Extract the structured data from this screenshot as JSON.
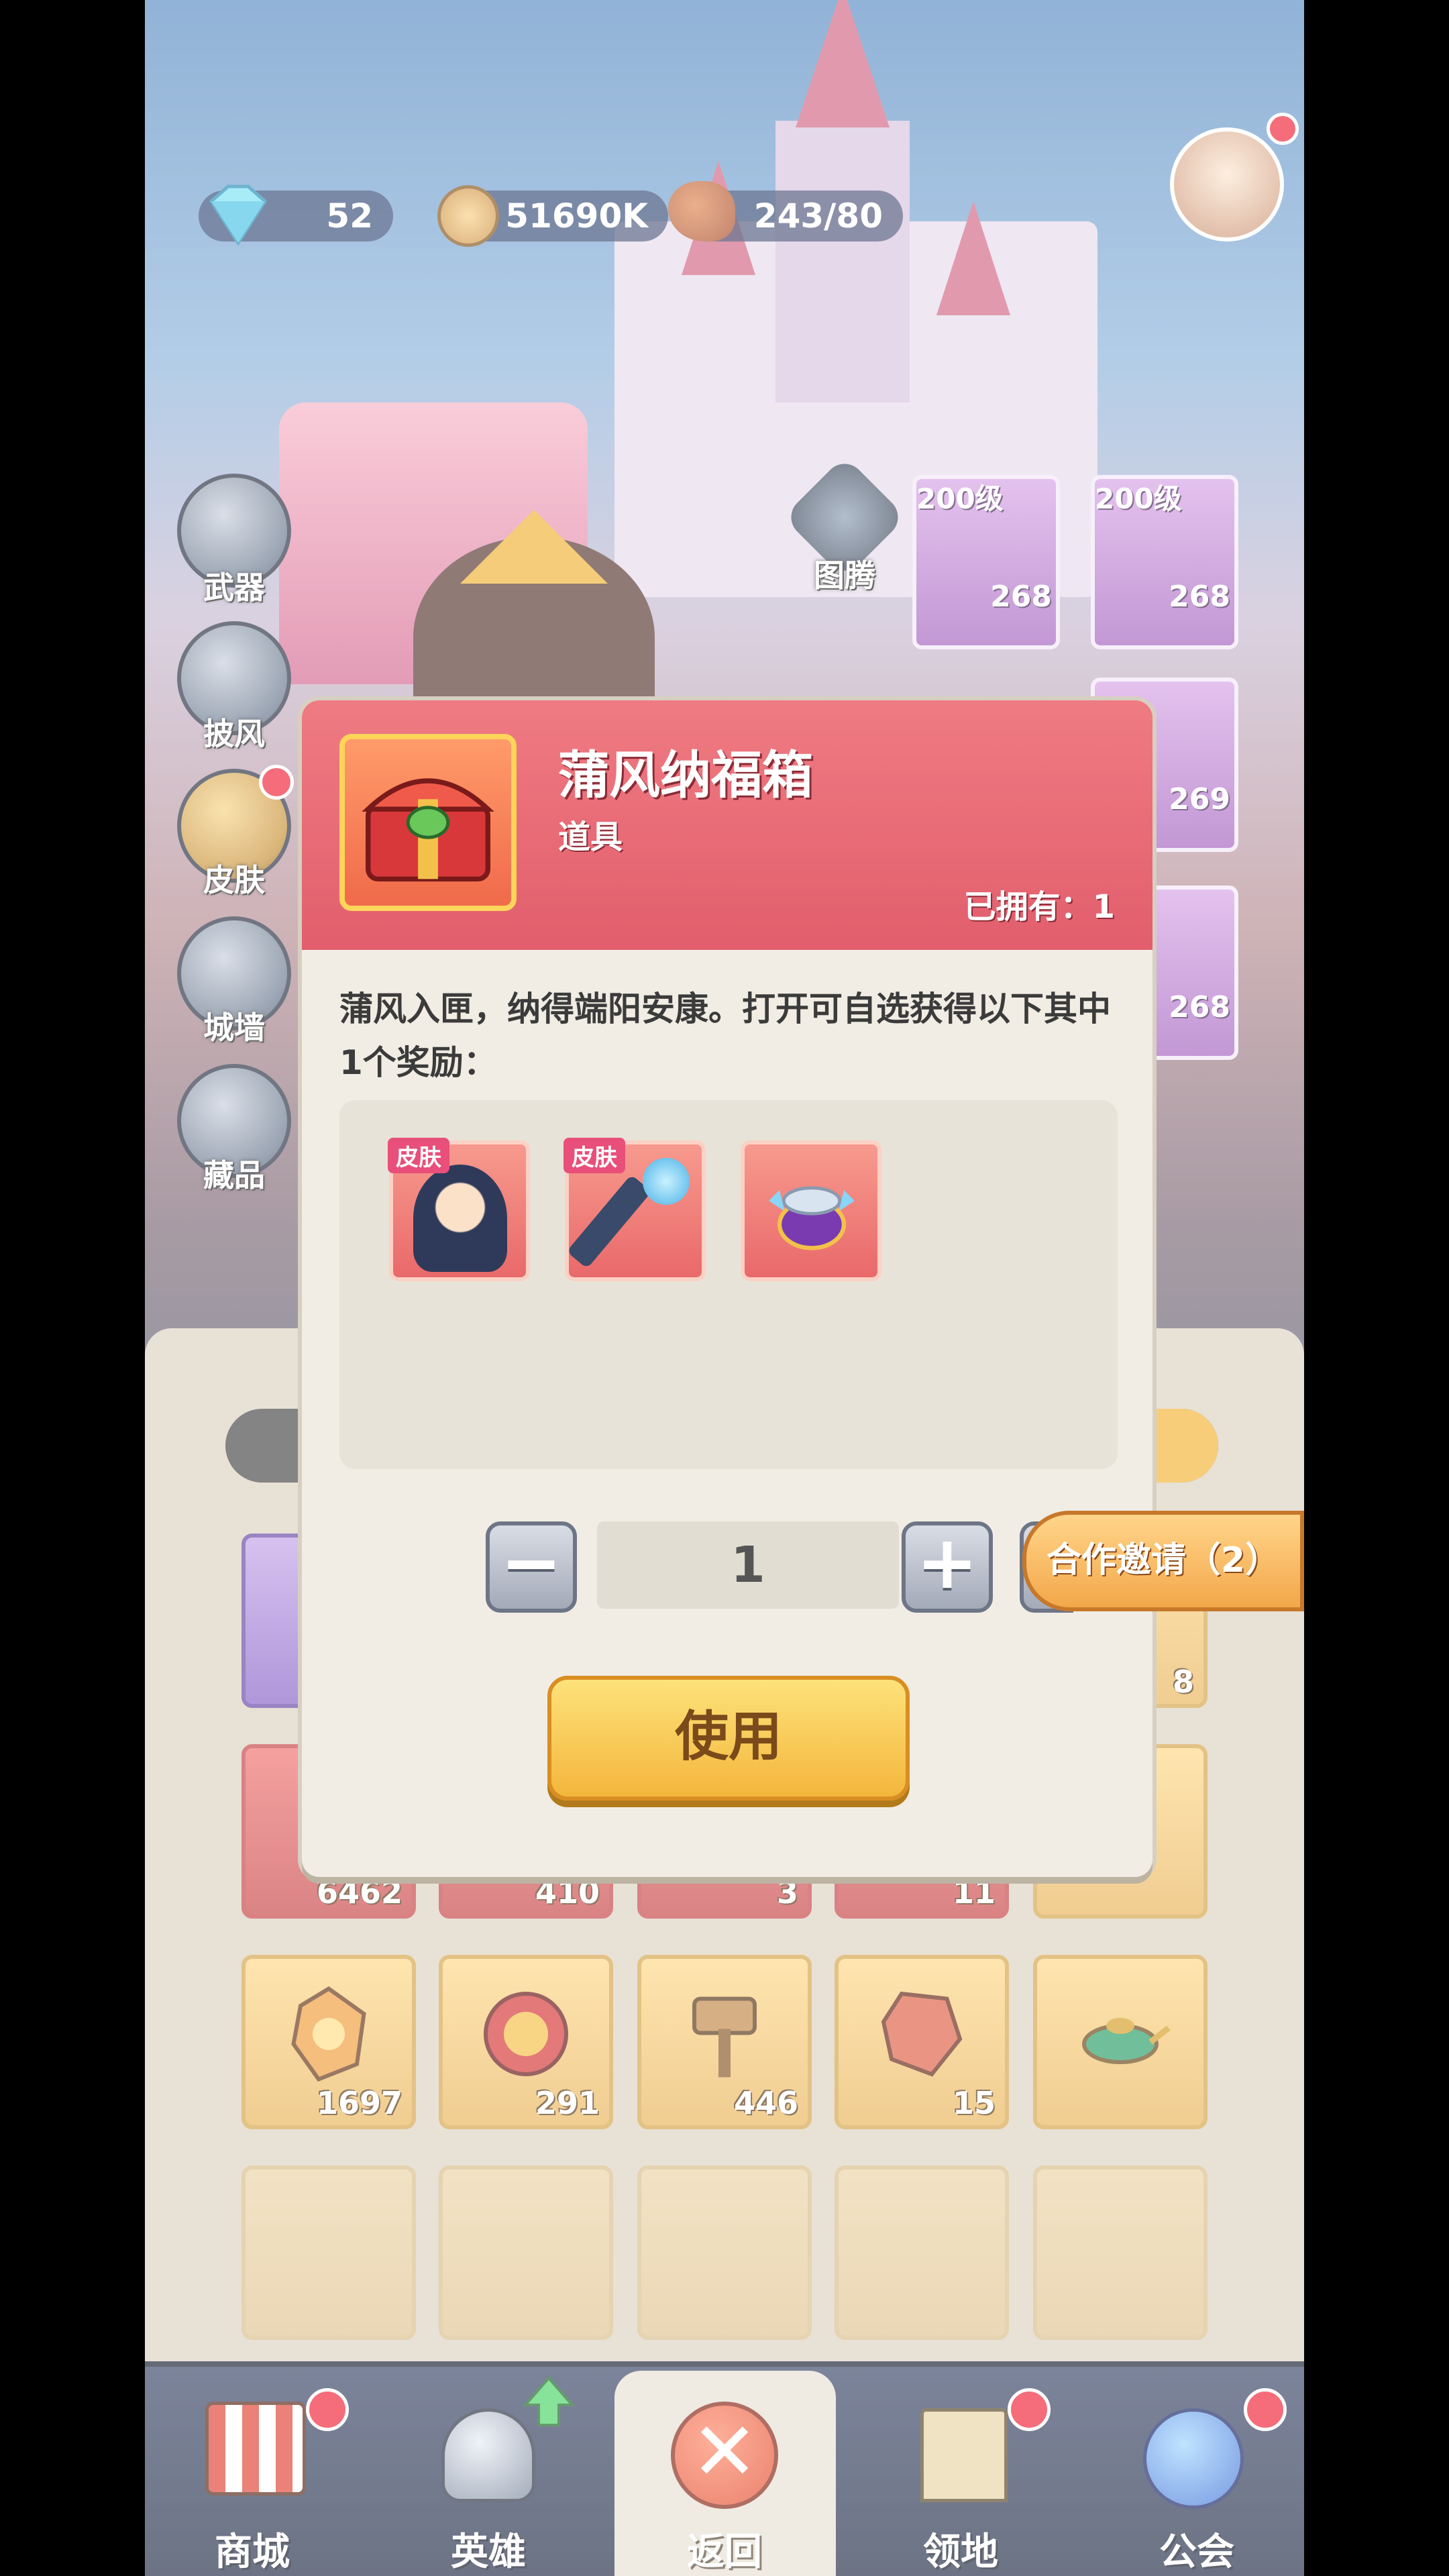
{
  "currencies": {
    "diamond": {
      "icon": "diamond-icon",
      "value": "52"
    },
    "gold": {
      "icon": "gold-coin-icon",
      "value": "51690K"
    },
    "stamina": {
      "icon": "meat-icon",
      "value": "243/80"
    }
  },
  "side_menu": [
    {
      "label": "武器",
      "icon": "weapon-icon"
    },
    {
      "label": "披风",
      "icon": "cape-icon"
    },
    {
      "label": "皮肤",
      "icon": "skin-icon"
    },
    {
      "label": "城墙",
      "icon": "wall-icon"
    },
    {
      "label": "藏品",
      "icon": "collection-icon"
    }
  ],
  "totem": {
    "label": "图腾"
  },
  "equipment": [
    {
      "level": "200级",
      "count": "268"
    },
    {
      "level": "200级",
      "count": "268"
    },
    {
      "count": "269"
    },
    {
      "count": "268"
    }
  ],
  "inventory": {
    "row1": [
      "6462",
      "410",
      "3",
      "11",
      ""
    ],
    "row2": [
      "1697",
      "291",
      "446",
      "15",
      ""
    ],
    "partial_count": "8"
  },
  "dialog": {
    "title": "蒲风纳福箱",
    "type": "道具",
    "owned": "已拥有：1",
    "description": "蒲风入匣，纳得端阳安康。打开可自选获得以下其中1个奖励：",
    "rewards": [
      {
        "tag": "皮肤",
        "name": "hero-skin"
      },
      {
        "tag": "皮肤",
        "name": "weapon-skin"
      },
      {
        "tag": "",
        "name": "treasure-pot"
      }
    ],
    "quantity": "1",
    "use_label": "使用"
  },
  "coop_invite": "合作邀请（2）",
  "nav": [
    {
      "label": "商城",
      "icon": "shop-icon",
      "badge": true
    },
    {
      "label": "英雄",
      "icon": "hero-helmet-icon",
      "badge": false
    },
    {
      "label": "返回",
      "icon": "close-icon",
      "badge": false
    },
    {
      "label": "领地",
      "icon": "territory-icon",
      "badge": true
    },
    {
      "label": "公会",
      "icon": "guild-planet-icon",
      "badge": true
    }
  ],
  "colors": {
    "dialog_header": "#e25e6c",
    "use_button": "#f4b63c",
    "badge": "#f0283c"
  }
}
